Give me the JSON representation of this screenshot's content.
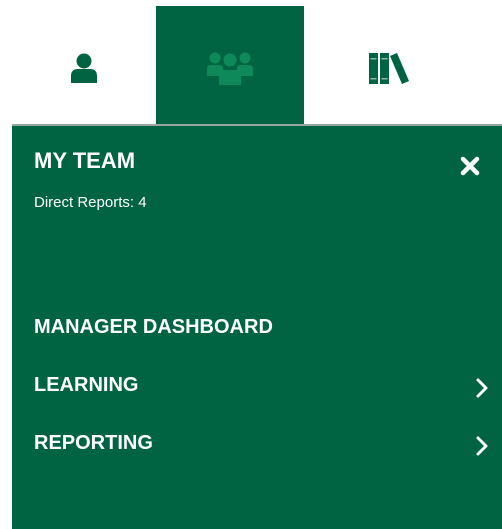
{
  "colors": {
    "brand_green": "#006341",
    "white": "#ffffff",
    "divider": "#9aa5a0"
  },
  "tabs": [
    {
      "icon": "user-icon",
      "active": false
    },
    {
      "icon": "team-icon",
      "active": true
    },
    {
      "icon": "library-books-icon",
      "active": false
    }
  ],
  "panel": {
    "title": "MY TEAM",
    "subtitle": "Direct Reports: 4",
    "close_icon": "close-icon"
  },
  "menu": [
    {
      "label": "MANAGER DASHBOARD",
      "has_submenu": false
    },
    {
      "label": "LEARNING",
      "has_submenu": true
    },
    {
      "label": "REPORTING",
      "has_submenu": true
    }
  ]
}
